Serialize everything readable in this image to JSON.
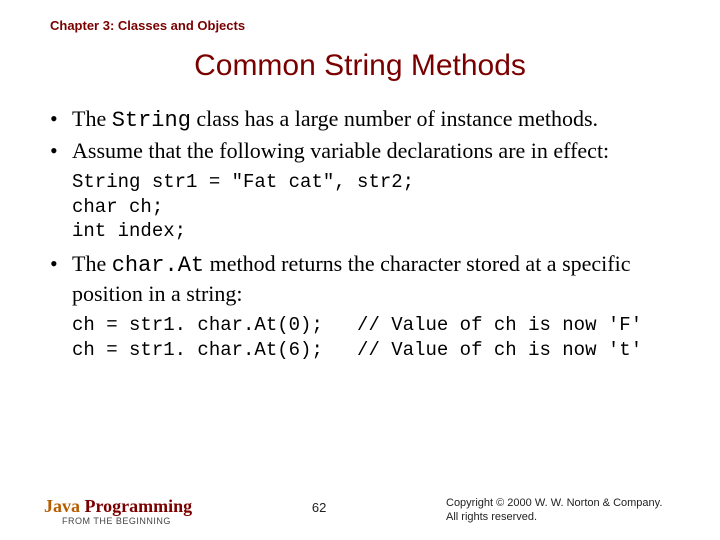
{
  "chapter": "Chapter 3: Classes and Objects",
  "title": "Common String Methods",
  "bullets": [
    {
      "pre": "The ",
      "code": "String",
      "post": " class has a large number of instance methods."
    },
    {
      "pre": "Assume that the following variable declarations are in effect:",
      "code": "",
      "post": ""
    }
  ],
  "code1": "String str1 = \"Fat cat\", str2;\nchar ch;\nint index;",
  "bullet3": {
    "pre": "The ",
    "code": "char.At",
    "post": " method returns the character stored at a specific position in a string:"
  },
  "code2": "ch = str1. char.At(0);   // Value of ch is now 'F'\nch = str1. char.At(6);   // Value of ch is now 't'",
  "footer": {
    "brand_java": "Java",
    "brand_prog": " Programming",
    "brand_sub": "FROM THE BEGINNING",
    "page": "62",
    "copyright_l1": "Copyright © 2000 W. W. Norton & Company.",
    "copyright_l2": "All rights reserved."
  }
}
